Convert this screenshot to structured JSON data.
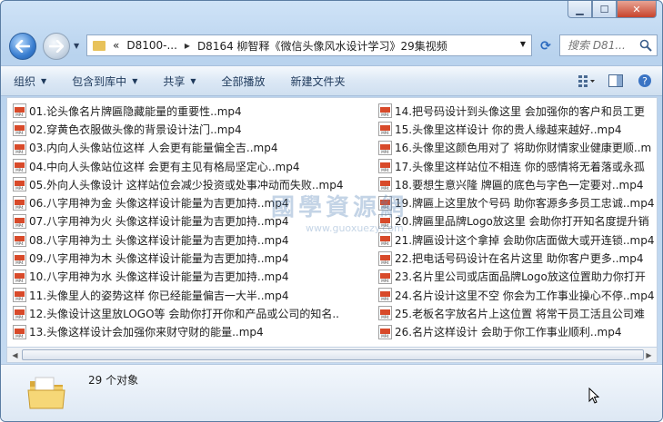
{
  "window": {
    "caption": {
      "minimize": "▁",
      "maximize": "☐",
      "close": "✕"
    }
  },
  "address": {
    "chevron": "«",
    "crumbs": [
      "D8100-...",
      "D8164 柳智释《微信头像风水设计学习》29集视频"
    ],
    "search_placeholder": "搜索 D81..."
  },
  "toolbar": {
    "organize": "组织",
    "include_in_library": "包含到库中",
    "share": "共享",
    "play_all": "全部播放",
    "new_folder": "新建文件夹"
  },
  "watermark": {
    "big": "國學資源網",
    "small": "www.guoxuezy.com"
  },
  "files": {
    "col1": [
      "01.论头像名片牌匾隐藏能量的重要性..mp4",
      "02.穿黄色衣服做头像的背景设计法门..mp4",
      "03.内向人头像站位这样 人会更有能量偏全吉..mp4",
      "04.中向人头像站位这样 会更有主见有格局坚定心..mp4",
      "05.外向人头像设计 这样站位会减少投资或处事冲动而失败..mp4",
      "06.八字用神为金 头像这样设计能量为吉更加持..mp4",
      "07.八字用神为火 头像这样设计能量为吉更加持..mp4",
      "08.八字用神为土 头像这样设计能量为吉更加持..mp4",
      "09.八字用神为木 头像这样设计能量为吉更加持..mp4",
      "10.八字用神为水 头像这样设计能量为吉更加持..mp4",
      "11.头像里人的姿势这样 你已经能量偏吉一大半..mp4",
      "12.头像设计这里放LOGO等 会助你打开你和产品或公司的知名..",
      "13.头像这样设计会加强你来财守财的能量..mp4"
    ],
    "col2": [
      "14.把号码设计到头像这里 会加强你的客户和员工更",
      "15.头像里这样设计 你的贵人缘越来越好..mp4",
      "16.头像里这颜色用对了 将助你财情家业健康更顺..m",
      "17.头像里这样站位不相连 你的感情将无着落或永孤",
      "18.要想生意兴隆 牌匾的底色与字色一定要对..mp4",
      "19.牌匾上这里放个号码 助你客源多多员工忠诚..mp4",
      "20.牌匾里品牌Logo放这里 会助你打开知名度提升销",
      "21.牌匾设计这个拿掉 会助你店面做大或开连锁..mp4",
      "22.把电话号码设计在名片这里 助你客户更多..mp4",
      "23.名片里公司或店面品牌Logo放这位置助力你打开",
      "24.名片设计这里不空 你会为工作事业操心不停..mp4",
      "25.老板名字放名片上这位置 将常干员工活且公司难",
      "26.名片这样设计 会助于你工作事业顺利..mp4"
    ],
    "icon_tag": "MP4"
  },
  "details": {
    "count": "29 个对象"
  }
}
